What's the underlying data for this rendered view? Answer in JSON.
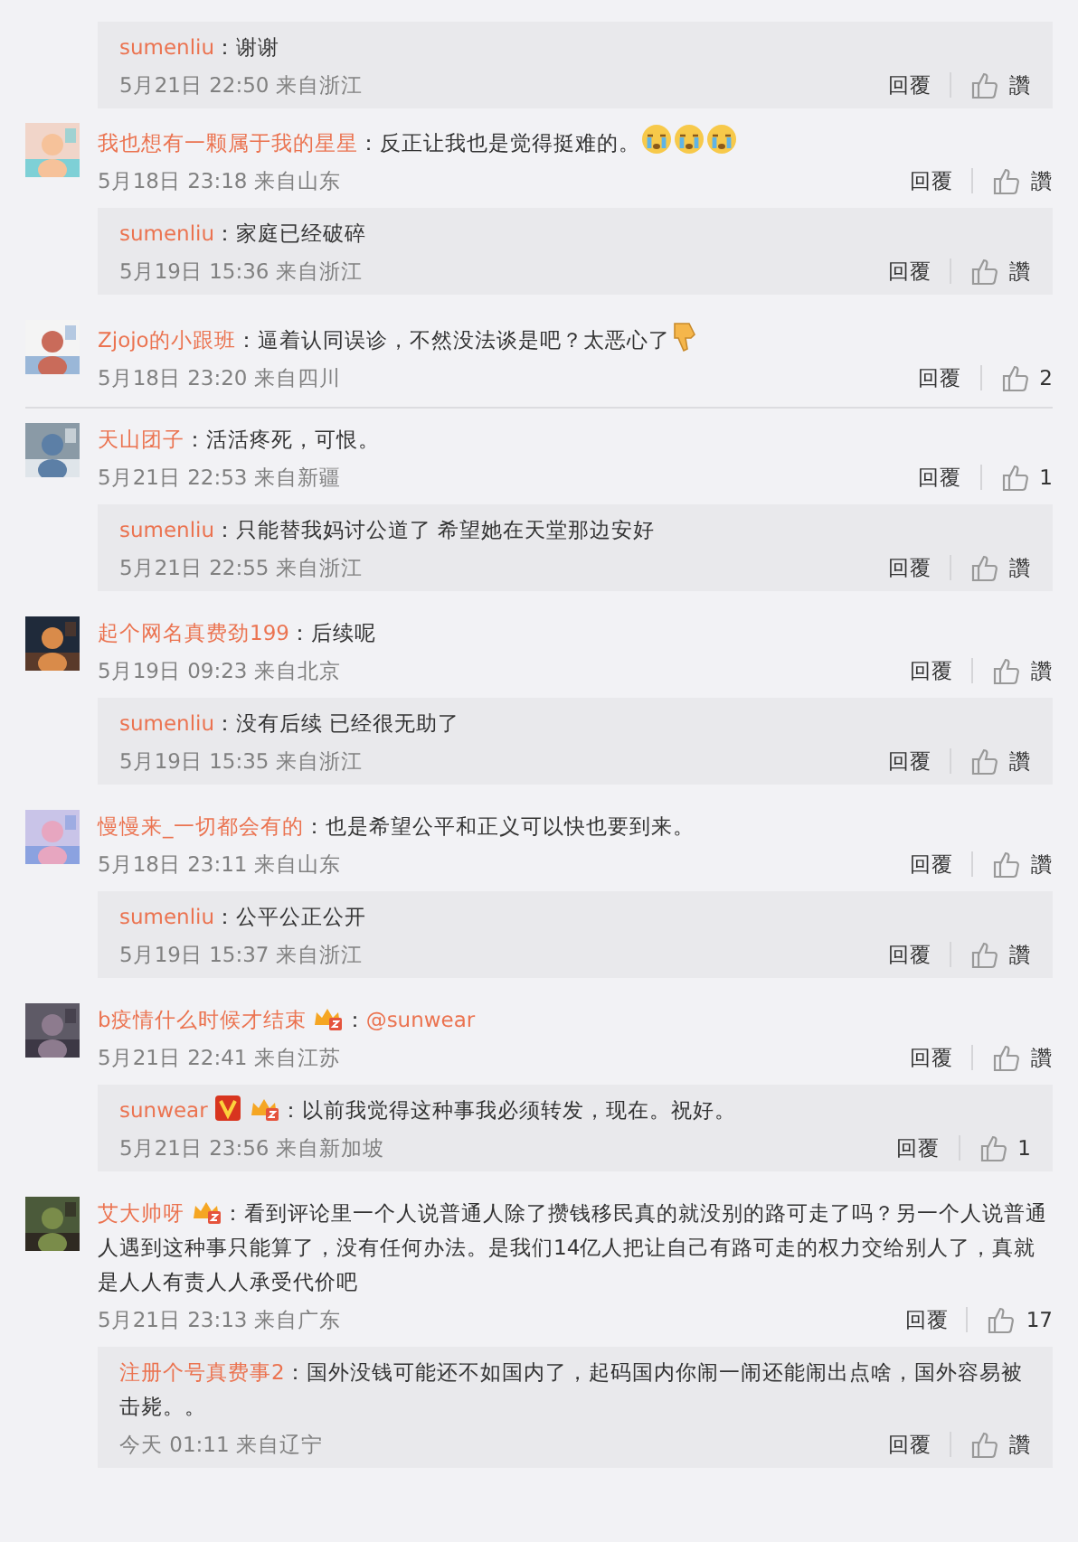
{
  "partial_reply": {
    "user": "sumenliu",
    "text": "：谢谢",
    "meta": "5月21日 22:50 来自浙江",
    "reply_label": "回覆",
    "like_label": "讚"
  },
  "comments": [
    {
      "user": "我也想有一颗属于我的星星",
      "text": "：反正让我也是觉得挺难的。",
      "emojis": [
        {
          "kind": "crying"
        },
        {
          "kind": "crying"
        },
        {
          "kind": "crying"
        }
      ],
      "meta": "5月18日 23:18 来自山东",
      "reply_label": "回覆",
      "like_label": "讚",
      "replies": [
        {
          "user": "sumenliu",
          "text": "：家庭已经破碎",
          "meta": "5月19日 15:36 来自浙江",
          "reply_label": "回覆",
          "like_label": "讚"
        }
      ]
    },
    {
      "user": "Zjojo的小跟班",
      "text": "：逼着认同误诊，不然没法谈是吧？太恶心了",
      "emojis": [
        {
          "kind": "thumbs-down"
        }
      ],
      "meta": "5月18日 23:20 来自四川",
      "reply_label": "回覆",
      "like_label": "2"
    },
    {
      "user": "天山团子",
      "text": "：活活疼死，可恨。",
      "meta": "5月21日 22:53 来自新疆",
      "reply_label": "回覆",
      "like_label": "1",
      "replies": [
        {
          "user": "sumenliu",
          "text": "：只能替我妈讨公道了 希望她在天堂那边安好",
          "meta": "5月21日 22:55 来自浙江",
          "reply_label": "回覆",
          "like_label": "讚"
        }
      ]
    },
    {
      "user": "起个网名真费劲199",
      "text": "：后续呢",
      "meta": "5月19日 09:23 来自北京",
      "reply_label": "回覆",
      "like_label": "讚",
      "replies": [
        {
          "user": "sumenliu",
          "text": "：没有后续 已经很无助了",
          "meta": "5月19日 15:35 来自浙江",
          "reply_label": "回覆",
          "like_label": "讚"
        }
      ]
    },
    {
      "user": "慢慢来_一切都会有的",
      "text": "：也是希望公平和正义可以快也要到来。",
      "meta": "5月18日 23:11 来自山东",
      "reply_label": "回覆",
      "like_label": "讚",
      "replies": [
        {
          "user": "sumenliu",
          "text": "：公平公正公开",
          "meta": "5月19日 15:37 来自浙江",
          "reply_label": "回覆",
          "like_label": "讚"
        }
      ]
    },
    {
      "user": "b疫情什么时候才结束",
      "badges": [
        {
          "kind": "vip"
        }
      ],
      "text": "：",
      "mention": "@sunwear",
      "meta": "5月21日 22:41 来自江苏",
      "reply_label": "回覆",
      "like_label": "讚",
      "replies": [
        {
          "user": "sunwear",
          "badges": [
            {
              "kind": "verified"
            },
            {
              "kind": "vip"
            }
          ],
          "text": "：以前我觉得这种事我必须转发，现在。祝好。",
          "meta": "5月21日 23:56 来自新加坡",
          "reply_label": "回覆",
          "like_label": "1"
        }
      ]
    },
    {
      "user": "艾大帅呀",
      "badges": [
        {
          "kind": "vip"
        }
      ],
      "text": "：看到评论里一个人说普通人除了攒钱移民真的就没别的路可走了吗？另一个人说普通人遇到这种事只能算了，没有任何办法。是我们14亿人把让自己有路可走的权力交给别人了，真就是人人有责人人承受代价吧",
      "meta": "5月21日 23:13 来自广东",
      "reply_label": "回覆",
      "like_label": "17",
      "replies": [
        {
          "user": "注册个号真费事2",
          "text": "：国外没钱可能还不如国内了，起码国内你闹一闹还能闹出点啥，国外容易被击毙。。",
          "meta": "今天 01:11 来自辽宁",
          "reply_label": "回覆",
          "like_label": "讚"
        }
      ]
    }
  ]
}
